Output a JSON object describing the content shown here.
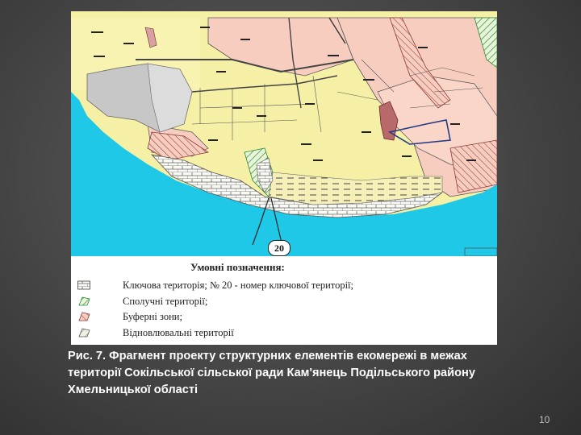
{
  "map": {
    "callout_label": "20",
    "legend": {
      "title": "Умовні позначення:",
      "items": [
        {
          "symbol": "key-territory",
          "text": "Ключова територія; № 20 - номер ключової території;"
        },
        {
          "symbol": "connecting-territory",
          "text": "Сполучні території;"
        },
        {
          "symbol": "buffer-zone",
          "text": "Буферні зони;"
        },
        {
          "symbol": "restoration-territory",
          "text": "Відновлювальні території"
        }
      ]
    },
    "colors": {
      "water": "#1ec8e6",
      "field_yellow": "#f5f0a6",
      "parcel_pink": "#f7cdbf",
      "settlement_gray": "#c7c7c7",
      "green_hatch": "#2e8b3a",
      "brown_hatch": "#8b3a3a"
    }
  },
  "caption": "Рис. 7. Фрагмент проекту структурних елементів екомережі в межах території Сокільської сільської ради Кам'янець Подільського району Хмельницької області",
  "page_number": "10"
}
